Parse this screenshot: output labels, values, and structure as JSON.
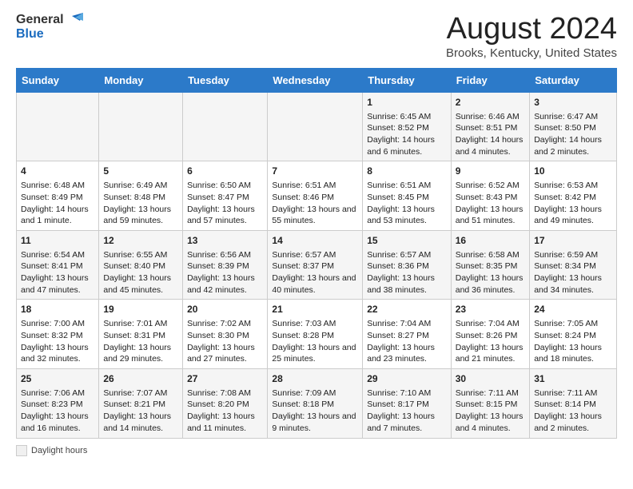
{
  "logo": {
    "general": "General",
    "blue": "Blue"
  },
  "title": "August 2024",
  "subtitle": "Brooks, Kentucky, United States",
  "days_of_week": [
    "Sunday",
    "Monday",
    "Tuesday",
    "Wednesday",
    "Thursday",
    "Friday",
    "Saturday"
  ],
  "legend_label": "Daylight hours",
  "weeks": [
    [
      {
        "day": "",
        "content": ""
      },
      {
        "day": "",
        "content": ""
      },
      {
        "day": "",
        "content": ""
      },
      {
        "day": "",
        "content": ""
      },
      {
        "day": "1",
        "content": "Sunrise: 6:45 AM\nSunset: 8:52 PM\nDaylight: 14 hours and 6 minutes."
      },
      {
        "day": "2",
        "content": "Sunrise: 6:46 AM\nSunset: 8:51 PM\nDaylight: 14 hours and 4 minutes."
      },
      {
        "day": "3",
        "content": "Sunrise: 6:47 AM\nSunset: 8:50 PM\nDaylight: 14 hours and 2 minutes."
      }
    ],
    [
      {
        "day": "4",
        "content": "Sunrise: 6:48 AM\nSunset: 8:49 PM\nDaylight: 14 hours and 1 minute."
      },
      {
        "day": "5",
        "content": "Sunrise: 6:49 AM\nSunset: 8:48 PM\nDaylight: 13 hours and 59 minutes."
      },
      {
        "day": "6",
        "content": "Sunrise: 6:50 AM\nSunset: 8:47 PM\nDaylight: 13 hours and 57 minutes."
      },
      {
        "day": "7",
        "content": "Sunrise: 6:51 AM\nSunset: 8:46 PM\nDaylight: 13 hours and 55 minutes."
      },
      {
        "day": "8",
        "content": "Sunrise: 6:51 AM\nSunset: 8:45 PM\nDaylight: 13 hours and 53 minutes."
      },
      {
        "day": "9",
        "content": "Sunrise: 6:52 AM\nSunset: 8:43 PM\nDaylight: 13 hours and 51 minutes."
      },
      {
        "day": "10",
        "content": "Sunrise: 6:53 AM\nSunset: 8:42 PM\nDaylight: 13 hours and 49 minutes."
      }
    ],
    [
      {
        "day": "11",
        "content": "Sunrise: 6:54 AM\nSunset: 8:41 PM\nDaylight: 13 hours and 47 minutes."
      },
      {
        "day": "12",
        "content": "Sunrise: 6:55 AM\nSunset: 8:40 PM\nDaylight: 13 hours and 45 minutes."
      },
      {
        "day": "13",
        "content": "Sunrise: 6:56 AM\nSunset: 8:39 PM\nDaylight: 13 hours and 42 minutes."
      },
      {
        "day": "14",
        "content": "Sunrise: 6:57 AM\nSunset: 8:37 PM\nDaylight: 13 hours and 40 minutes."
      },
      {
        "day": "15",
        "content": "Sunrise: 6:57 AM\nSunset: 8:36 PM\nDaylight: 13 hours and 38 minutes."
      },
      {
        "day": "16",
        "content": "Sunrise: 6:58 AM\nSunset: 8:35 PM\nDaylight: 13 hours and 36 minutes."
      },
      {
        "day": "17",
        "content": "Sunrise: 6:59 AM\nSunset: 8:34 PM\nDaylight: 13 hours and 34 minutes."
      }
    ],
    [
      {
        "day": "18",
        "content": "Sunrise: 7:00 AM\nSunset: 8:32 PM\nDaylight: 13 hours and 32 minutes."
      },
      {
        "day": "19",
        "content": "Sunrise: 7:01 AM\nSunset: 8:31 PM\nDaylight: 13 hours and 29 minutes."
      },
      {
        "day": "20",
        "content": "Sunrise: 7:02 AM\nSunset: 8:30 PM\nDaylight: 13 hours and 27 minutes."
      },
      {
        "day": "21",
        "content": "Sunrise: 7:03 AM\nSunset: 8:28 PM\nDaylight: 13 hours and 25 minutes."
      },
      {
        "day": "22",
        "content": "Sunrise: 7:04 AM\nSunset: 8:27 PM\nDaylight: 13 hours and 23 minutes."
      },
      {
        "day": "23",
        "content": "Sunrise: 7:04 AM\nSunset: 8:26 PM\nDaylight: 13 hours and 21 minutes."
      },
      {
        "day": "24",
        "content": "Sunrise: 7:05 AM\nSunset: 8:24 PM\nDaylight: 13 hours and 18 minutes."
      }
    ],
    [
      {
        "day": "25",
        "content": "Sunrise: 7:06 AM\nSunset: 8:23 PM\nDaylight: 13 hours and 16 minutes."
      },
      {
        "day": "26",
        "content": "Sunrise: 7:07 AM\nSunset: 8:21 PM\nDaylight: 13 hours and 14 minutes."
      },
      {
        "day": "27",
        "content": "Sunrise: 7:08 AM\nSunset: 8:20 PM\nDaylight: 13 hours and 11 minutes."
      },
      {
        "day": "28",
        "content": "Sunrise: 7:09 AM\nSunset: 8:18 PM\nDaylight: 13 hours and 9 minutes."
      },
      {
        "day": "29",
        "content": "Sunrise: 7:10 AM\nSunset: 8:17 PM\nDaylight: 13 hours and 7 minutes."
      },
      {
        "day": "30",
        "content": "Sunrise: 7:11 AM\nSunset: 8:15 PM\nDaylight: 13 hours and 4 minutes."
      },
      {
        "day": "31",
        "content": "Sunrise: 7:11 AM\nSunset: 8:14 PM\nDaylight: 13 hours and 2 minutes."
      }
    ]
  ]
}
